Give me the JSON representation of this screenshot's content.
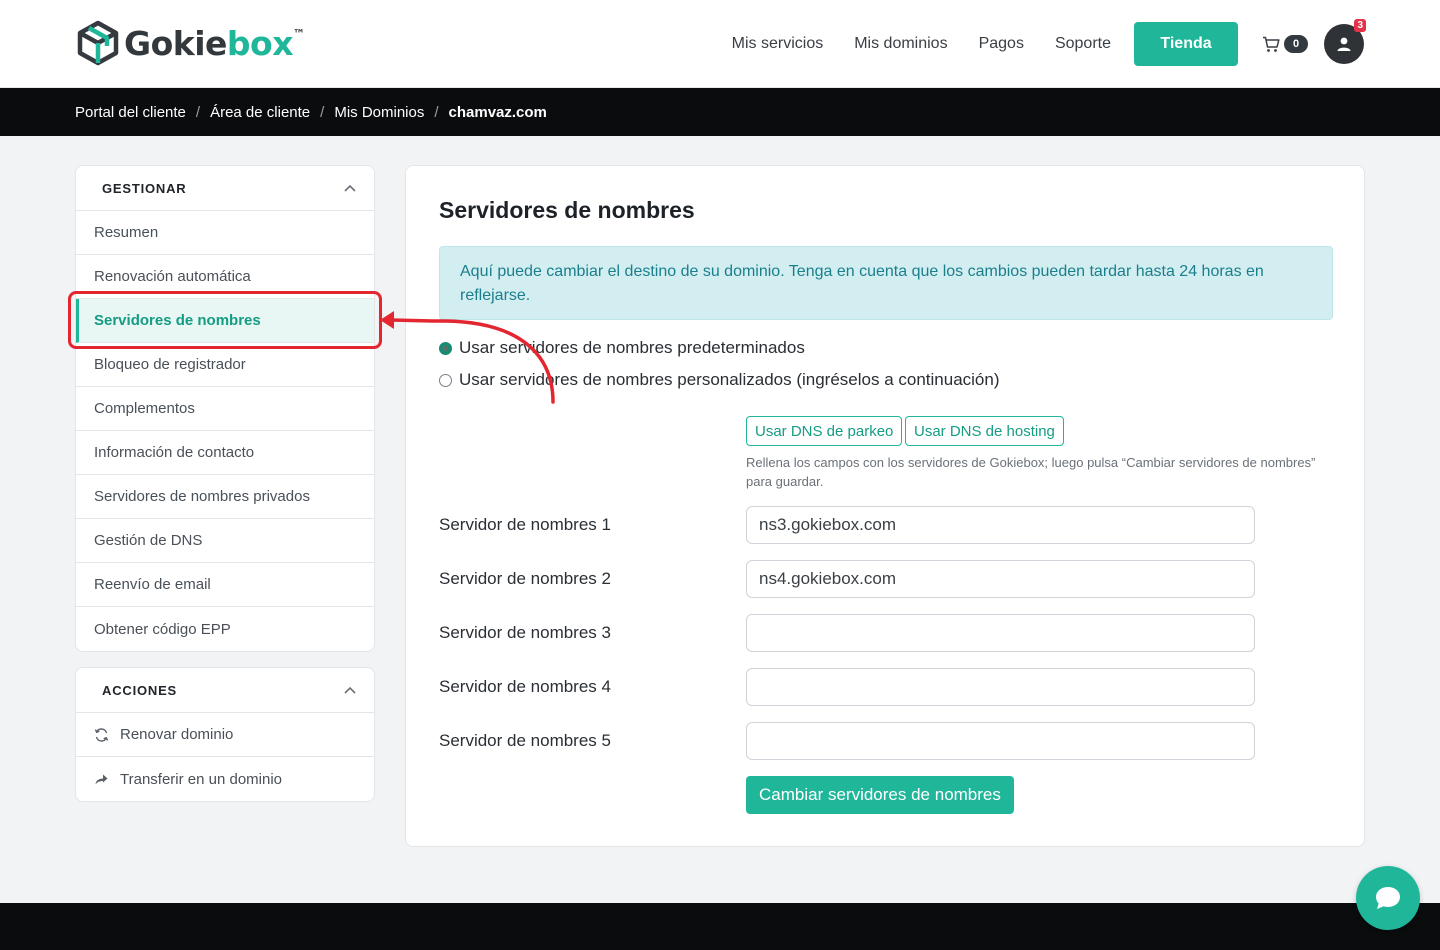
{
  "brand": {
    "name_main": "Gokie",
    "name_accent": "box",
    "trademark": "™",
    "accent_color": "#1fb69a"
  },
  "nav": {
    "links": [
      "Mis servicios",
      "Mis dominios",
      "Pagos",
      "Soporte"
    ],
    "store_button": "Tienda",
    "cart_count": "0",
    "notification_count": "3"
  },
  "breadcrumb": [
    "Portal del cliente",
    "Área de cliente",
    "Mis Dominios",
    "chamvaz.com"
  ],
  "sidebar": {
    "manage": {
      "title": "GESTIONAR",
      "items": [
        "Resumen",
        "Renovación automática",
        "Servidores de nombres",
        "Bloqueo de registrador",
        "Complementos",
        "Información de contacto",
        "Servidores de nombres privados",
        "Gestión de DNS",
        "Reenvío de email",
        "Obtener código EPP"
      ],
      "active_index": 2
    },
    "actions": {
      "title": "ACCIONES",
      "items": [
        {
          "label": "Renovar dominio",
          "icon": "refresh-icon"
        },
        {
          "label": "Transferir en un dominio",
          "icon": "share-icon"
        }
      ]
    }
  },
  "main": {
    "title": "Servidores de nombres",
    "info": "Aquí puede cambiar el destino de su dominio. Tenga en cuenta que los cambios pueden tardar hasta 24 horas en reflejarse.",
    "radio_default": "Usar servidores de nombres predeterminados",
    "radio_custom": "Usar servidores de nombres personalizados (ingréselos a continuación)",
    "selected_option": "default",
    "btn_parking": "Usar DNS de parkeo",
    "btn_hosting": "Usar DNS de hosting",
    "hint": "Rellena los campos con los servidores de Gokiebox; luego pulsa “Cambiar servidores de nombres” para guardar.",
    "nameservers": [
      {
        "label": "Servidor de nombres 1",
        "value": "ns3.gokiebox.com"
      },
      {
        "label": "Servidor de nombres 2",
        "value": "ns4.gokiebox.com"
      },
      {
        "label": "Servidor de nombres 3",
        "value": ""
      },
      {
        "label": "Servidor de nombres 4",
        "value": ""
      },
      {
        "label": "Servidor de nombres 5",
        "value": ""
      }
    ],
    "submit": "Cambiar servidores de nombres"
  }
}
